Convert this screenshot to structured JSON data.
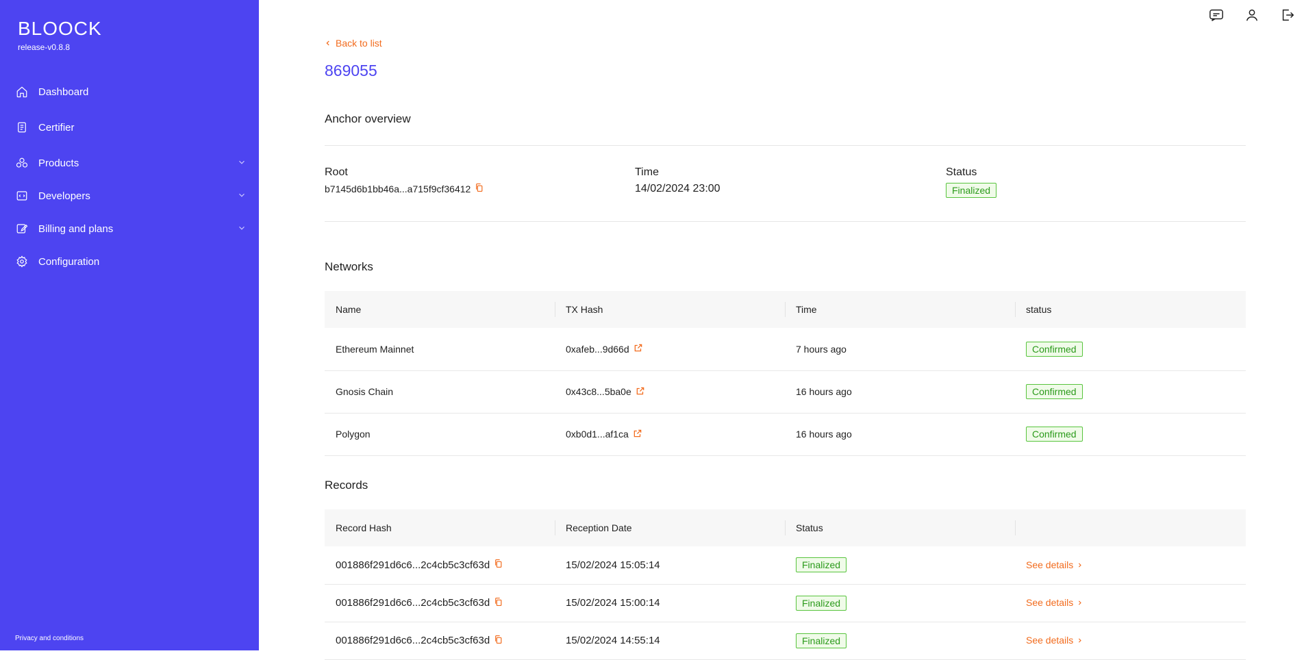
{
  "sidebar": {
    "logo": "BLOOCK",
    "version": "release-v0.8.8",
    "items": [
      {
        "label": "Dashboard",
        "icon": "home-icon"
      },
      {
        "label": "Certifier",
        "icon": "document-icon"
      },
      {
        "label": "Products",
        "icon": "products-icon",
        "expandable": true
      },
      {
        "label": "Developers",
        "icon": "code-icon",
        "expandable": true
      },
      {
        "label": "Billing and plans",
        "icon": "edit-icon",
        "expandable": true
      },
      {
        "label": "Configuration",
        "icon": "gear-icon"
      }
    ],
    "privacy": "Privacy and conditions"
  },
  "topbar": {
    "icons": [
      "chat-icon",
      "user-icon",
      "logout-icon"
    ]
  },
  "main": {
    "back_label": "Back to list",
    "title": "869055",
    "overview": {
      "title": "Anchor overview",
      "root_label": "Root",
      "root_value": "b7145d6b1bb46a...a715f9cf36412",
      "time_label": "Time",
      "time_value": "14/02/2024 23:00",
      "status_label": "Status",
      "status_value": "Finalized"
    },
    "networks": {
      "title": "Networks",
      "columns": [
        "Name",
        "TX Hash",
        "Time",
        "status"
      ],
      "rows": [
        {
          "name": "Ethereum Mainnet",
          "tx": "0xafeb...9d66d",
          "time": "7 hours ago",
          "status": "Confirmed"
        },
        {
          "name": "Gnosis Chain",
          "tx": "0x43c8...5ba0e",
          "time": "16 hours ago",
          "status": "Confirmed"
        },
        {
          "name": "Polygon",
          "tx": "0xb0d1...af1ca",
          "time": "16 hours ago",
          "status": "Confirmed"
        }
      ]
    },
    "records": {
      "title": "Records",
      "columns": [
        "Record Hash",
        "Reception Date",
        "Status",
        ""
      ],
      "rows": [
        {
          "hash": "001886f291d6c6...2c4cb5c3cf63d",
          "date": "15/02/2024 15:05:14",
          "status": "Finalized",
          "action": "See details"
        },
        {
          "hash": "001886f291d6c6...2c4cb5c3cf63d",
          "date": "15/02/2024 15:00:14",
          "status": "Finalized",
          "action": "See details"
        },
        {
          "hash": "001886f291d6c6...2c4cb5c3cf63d",
          "date": "15/02/2024 14:55:14",
          "status": "Finalized",
          "action": "See details"
        }
      ]
    }
  },
  "colors": {
    "sidebar": "#4d44f1",
    "accent": "#f26b1d",
    "success": "#57c43c",
    "title": "#4d44f1"
  }
}
